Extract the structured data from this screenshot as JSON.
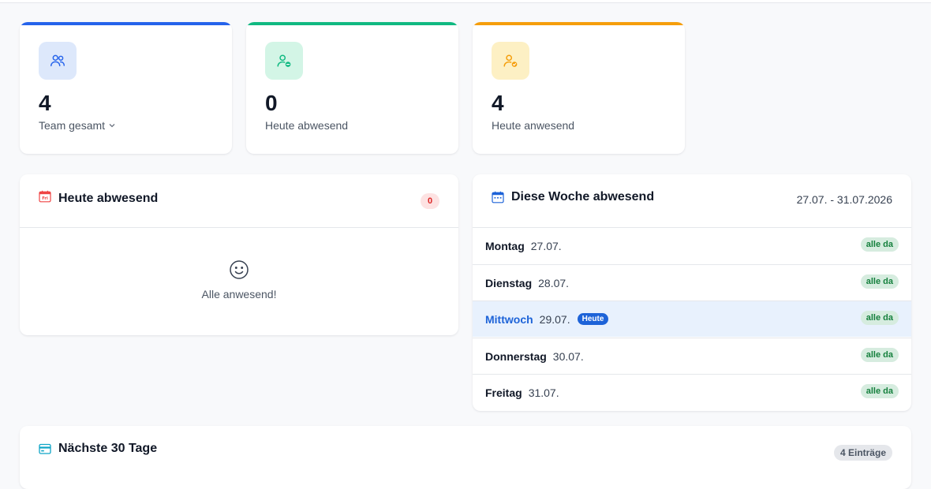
{
  "stats": [
    {
      "value": "4",
      "label": "Team gesamt",
      "icon": "team-icon",
      "accent": "#2563eb",
      "icon_bg": "#dde8fb"
    },
    {
      "value": "0",
      "label": "Heute abwesend",
      "icon": "user-absent-icon",
      "accent": "#10b981",
      "icon_bg": "#d3f5e6"
    },
    {
      "value": "4",
      "label": "Heute anwesend",
      "icon": "user-present-icon",
      "accent": "#f59e0b",
      "icon_bg": "#fdf0c4"
    }
  ],
  "today_panel": {
    "title": "Heute abwesend",
    "count": "0",
    "empty_text": "Alle anwesend!",
    "icon_label": "Fri"
  },
  "week_panel": {
    "title": "Diese Woche abwesend",
    "range": "27.07. - 31.07.2026",
    "today_label": "Heute",
    "days": [
      {
        "name": "Montag",
        "date": "27.07.",
        "status": "alle da"
      },
      {
        "name": "Dienstag",
        "date": "28.07.",
        "status": "alle da"
      },
      {
        "name": "Mittwoch",
        "date": "29.07.",
        "status": "alle da"
      },
      {
        "name": "Donnerstag",
        "date": "30.07.",
        "status": "alle da"
      },
      {
        "name": "Freitag",
        "date": "31.07.",
        "status": "alle da"
      }
    ]
  },
  "next_panel": {
    "title": "Nächste 30 Tage",
    "entries": "4 Einträge"
  },
  "colors": {
    "today_highlight": "#e8f1fd",
    "primary": "#1d63d8",
    "success_bg": "#d6ecdf",
    "success_text": "#15803d",
    "danger_bg": "#fde2e2",
    "danger_text": "#dc2626"
  }
}
